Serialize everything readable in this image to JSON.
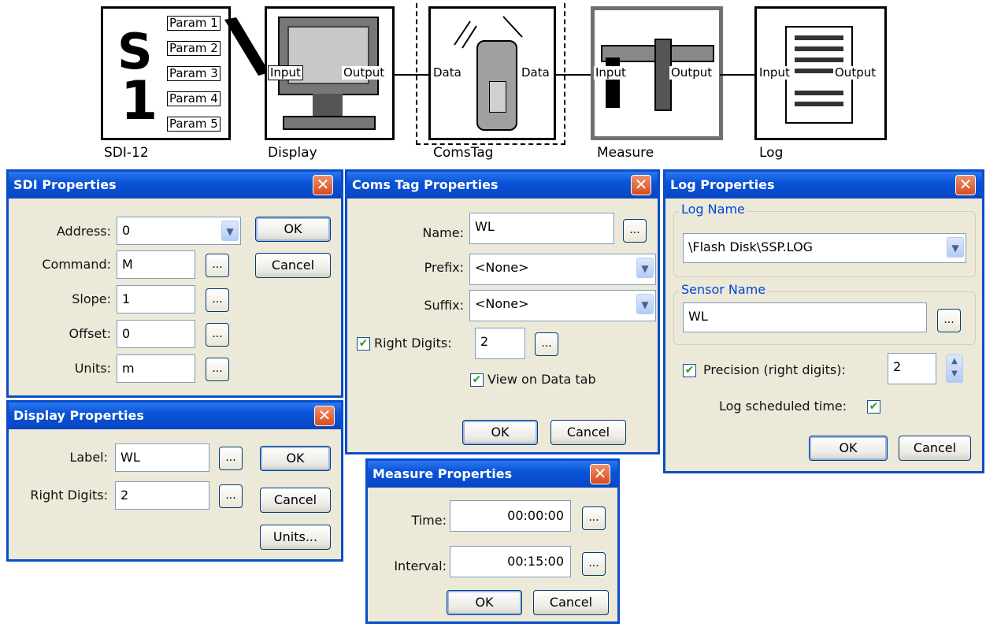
{
  "diagram": {
    "sdi": {
      "label": "SDI-12",
      "big_text": "S",
      "big_digit": "1",
      "ports": [
        "Param 1",
        "Param 2",
        "Param 3",
        "Param 4",
        "Param 5"
      ]
    },
    "display": {
      "label": "Display",
      "in": "Input",
      "out": "Output"
    },
    "comstag": {
      "label": "ComsTag",
      "in": "Data",
      "out": "Data"
    },
    "measure": {
      "label": "Measure",
      "in": "Input",
      "out": "Output"
    },
    "log": {
      "label": "Log",
      "in": "Input",
      "out": "Output"
    }
  },
  "sdi_props": {
    "title": "SDI Properties",
    "close": "✕",
    "address_label": "Address:",
    "address_value": "0",
    "command_label": "Command:",
    "command_value": "M",
    "slope_label": "Slope:",
    "slope_value": "1",
    "offset_label": "Offset:",
    "offset_value": "0",
    "units_label": "Units:",
    "units_value": "m",
    "ok": "OK",
    "cancel": "Cancel",
    "ellipsis": "..."
  },
  "display_props": {
    "title": "Display Properties",
    "close": "✕",
    "label_label": "Label:",
    "label_value": "WL",
    "digits_label": "Right Digits:",
    "digits_value": "2",
    "ok": "OK",
    "cancel": "Cancel",
    "units": "Units...",
    "ellipsis": "..."
  },
  "coms_props": {
    "title": "Coms Tag Properties",
    "close": "✕",
    "name_label": "Name:",
    "name_value": "WL",
    "prefix_label": "Prefix:",
    "prefix_value": "<None>",
    "suffix_label": "Suffix:",
    "suffix_value": "<None>",
    "digits_label": "Right Digits:",
    "digits_value": "2",
    "digits_checked": true,
    "view_label": "View on Data tab",
    "view_checked": true,
    "ok": "OK",
    "cancel": "Cancel",
    "ellipsis": "..."
  },
  "measure_props": {
    "title": "Measure Properties",
    "close": "✕",
    "time_label": "Time:",
    "time_value": "00:00:00",
    "interval_label": "Interval:",
    "interval_value": "00:15:00",
    "ok": "OK",
    "cancel": "Cancel",
    "ellipsis": "..."
  },
  "log_props": {
    "title": "Log Properties",
    "close": "✕",
    "logname_group": "Log Name",
    "logname_value": "\\Flash Disk\\SSP.LOG",
    "sensor_group": "Sensor Name",
    "sensor_value": "WL",
    "precision_label": "Precision (right digits):",
    "precision_value": "2",
    "precision_checked": true,
    "sched_label": "Log scheduled time:",
    "sched_checked": true,
    "ok": "OK",
    "cancel": "Cancel",
    "ellipsis": "..."
  },
  "icons": {
    "check": "✔",
    "arrow_down": "▼",
    "spin_up": "▲",
    "spin_down": "▼"
  },
  "colors": {
    "titlebar": "#0a54d8",
    "dialog_bg": "#ece9d8",
    "close": "#d64b1f",
    "group_label": "#0046d5"
  }
}
